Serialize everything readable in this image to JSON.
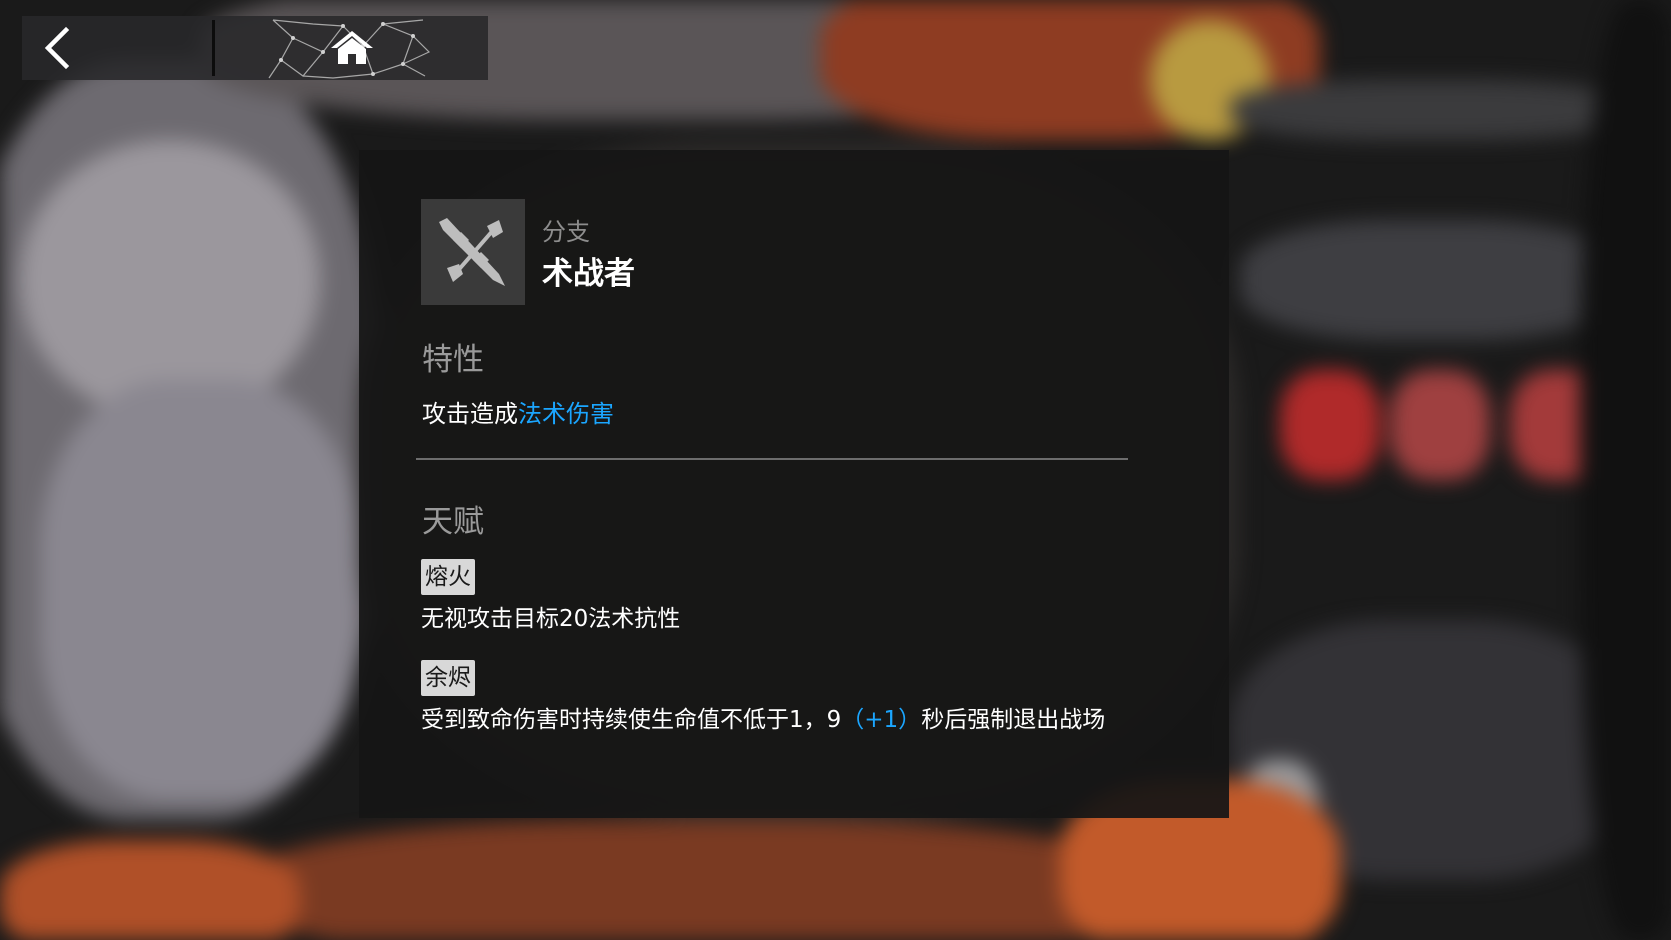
{
  "nav": {
    "back_icon": "chevron-left-icon",
    "home_icon": "home-icon"
  },
  "panel": {
    "branch_label": "分支",
    "branch_name": "术战者",
    "branch_icon": "crossed-swords-icon",
    "trait_title": "特性",
    "trait_desc_prefix": "攻击造成",
    "trait_desc_highlight": "法术伤害",
    "talent_title": "天赋",
    "talents": [
      {
        "name": "熔火",
        "desc": "无视攻击目标20法术抗性"
      },
      {
        "name": "余烬",
        "desc_before": "受到致命伤害时持续使生命值不低于1，9",
        "desc_bonus": "（+1）",
        "desc_after": "秒后强制退出战场"
      }
    ]
  },
  "colors": {
    "highlight": "#1ba6ff",
    "panel_bg": "#161515",
    "tag_bg": "#d8d8d8"
  }
}
